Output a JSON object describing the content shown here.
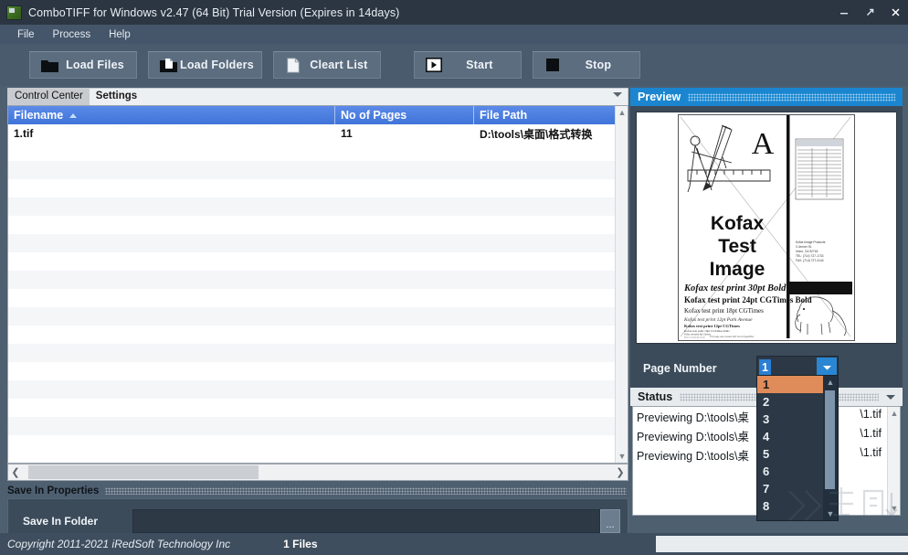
{
  "window": {
    "title": "ComboTIFF for Windows v2.47  (64 Bit)   Trial Version (Expires in 14days)",
    "icon": "app-icon",
    "controls": {
      "minimize": "minimize-icon",
      "maximize": "maximize-icon",
      "close": "close-icon"
    }
  },
  "menubar": {
    "items": [
      {
        "label": "File"
      },
      {
        "label": "Process"
      },
      {
        "label": "Help"
      }
    ]
  },
  "toolbar": {
    "buttons": [
      {
        "label": "Load Files",
        "icon": "folder-icon"
      },
      {
        "label": "Load Folders",
        "icon": "folder-document-icon"
      },
      {
        "label": "Cleart List",
        "icon": "page-icon"
      },
      {
        "label": "Start",
        "icon": "play-icon"
      },
      {
        "label": "Stop",
        "icon": "stop-square-icon"
      }
    ]
  },
  "tabs": {
    "items": [
      {
        "label": "Control Center",
        "active": true
      },
      {
        "label": "Settings",
        "active": false
      }
    ]
  },
  "file_grid": {
    "columns": [
      "Filename",
      "No of Pages",
      "File Path"
    ],
    "sort_column": "Filename",
    "sort_direction": "asc",
    "rows": [
      {
        "filename": "1.tif",
        "pages": "11",
        "path": "D:\\tools\\桌面\\格式转换"
      }
    ]
  },
  "save_in": {
    "section_title": "Save In Properties",
    "folder_label": "Save In Folder",
    "folder_value": "",
    "browse_label": "..."
  },
  "preview": {
    "title": "Preview",
    "image": {
      "alt": "Kofax Test Image",
      "big_letter": "A",
      "headline_lines": [
        "Kofax",
        "Test",
        "Image"
      ],
      "text_lines": [
        "Kofax test print 30pt Bold Italic",
        "Kofax test print 24pt CGTimes Bold",
        "Kofax test print 18pt CGTimes",
        "Kofax test print 12pt Park Avenue",
        "Kofax test print 12pt CGTimes",
        "Kofax test print 10pt CGTimes Italic",
        "Kofax test print 8pt Univers",
        "Kofax test print 6pt Courier"
      ],
      "address_block": [
        "Kofax Image Products",
        "3 Jenner St.",
        "Irvine, CA 92718",
        "TEL:   (714) 727-1733",
        "FAX:   (714) 727-3144"
      ],
      "footer": "This page was created with Xerox PageWriter and the Xerox 9700 Electronic Printing System."
    }
  },
  "page_number": {
    "label": "Page Number",
    "value": "1",
    "dropdown_icon": "chevron-down-icon",
    "options": [
      "1",
      "2",
      "3",
      "4",
      "5",
      "6",
      "7",
      "8"
    ],
    "selected": "1"
  },
  "status": {
    "title": "Status",
    "caret_icon": "caret-down-icon",
    "lines": [
      {
        "head": "Previewing D:\\tools\\桌",
        "tail": "\\1.tif"
      },
      {
        "head": "Previewing D:\\tools\\桌",
        "tail": "\\1.tif"
      },
      {
        "head": "Previewing D:\\tools\\桌",
        "tail": "\\1.tif"
      }
    ]
  },
  "statusbar": {
    "copyright": "Copyright 2011-2021 iRedSoft Technology Inc",
    "files": "1 Files"
  },
  "colors": {
    "titlebar": "#2b3642",
    "toolbar": "#4a5b6d",
    "accent_blue": "#1b86cf",
    "grid_header": "#4a7ddd",
    "dropdown_selected": "#e08b5a"
  }
}
